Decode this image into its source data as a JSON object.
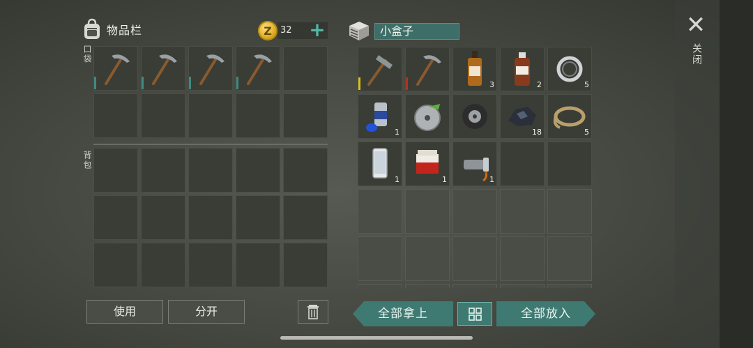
{
  "inventory": {
    "title": "物品栏",
    "pocket_label": "口袋",
    "backpack_label": "背包"
  },
  "currency": {
    "amount": "32",
    "coin_glyph": "Z",
    "add_icon": "plus-icon"
  },
  "pocket_slots": [
    {
      "item": "pickaxe",
      "count": ""
    },
    {
      "item": "pickaxe",
      "count": ""
    },
    {
      "item": "pickaxe",
      "count": ""
    },
    {
      "item": "pickaxe",
      "count": ""
    },
    {
      "item": "",
      "count": ""
    },
    {
      "item": "",
      "count": ""
    },
    {
      "item": "",
      "count": ""
    },
    {
      "item": "",
      "count": ""
    },
    {
      "item": "",
      "count": ""
    },
    {
      "item": "",
      "count": ""
    }
  ],
  "backpack_slots_count": 15,
  "container": {
    "name": "小盒子",
    "slots": [
      {
        "item": "hammer",
        "count": ""
      },
      {
        "item": "pickaxe",
        "count": ""
      },
      {
        "item": "whiskey-bottle",
        "count": "3"
      },
      {
        "item": "medicine-bottle",
        "count": "2"
      },
      {
        "item": "bearing-ring",
        "count": "5"
      },
      {
        "item": "spray-paint-can",
        "count": "1"
      },
      {
        "item": "saw-blade",
        "count": ""
      },
      {
        "item": "tire",
        "count": ""
      },
      {
        "item": "coal-ore",
        "count": "18"
      },
      {
        "item": "rope",
        "count": "5"
      },
      {
        "item": "smartphone",
        "count": "1"
      },
      {
        "item": "cigarette-pack",
        "count": "1"
      },
      {
        "item": "flashlight",
        "count": "1"
      }
    ]
  },
  "close": {
    "label": "关闭",
    "icon": "close-icon"
  },
  "buttons": {
    "use": "使用",
    "split": "分开",
    "take_all": "全部拿上",
    "put_all": "全部放入"
  },
  "colors": {
    "accent": "#3e7a72",
    "durability_green": "#3e8a84",
    "durability_yellow": "#d6c21c",
    "durability_red": "#b8301f"
  }
}
